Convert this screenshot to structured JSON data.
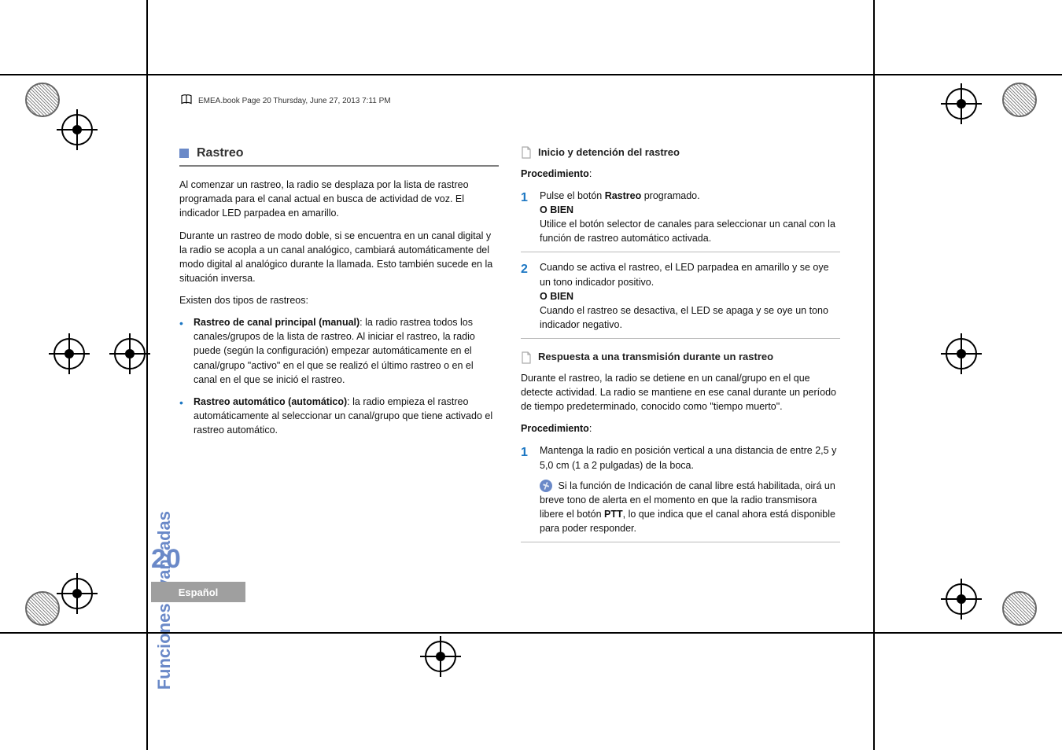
{
  "header": {
    "text": "EMEA.book  Page 20  Thursday, June 27, 2013  7:11 PM"
  },
  "side_tab": "Funciones avanzadas",
  "page_number": "20",
  "language": "Español",
  "left": {
    "title": "Rastreo",
    "p1": "Al comenzar un rastreo, la radio se desplaza por la lista de rastreo programada para el canal actual en busca de actividad de voz. El indicador LED parpadea en amarillo.",
    "p2": "Durante un rastreo de modo doble, si se encuentra en un canal digital y la radio se acopla a un canal analógico, cambiará automáticamente del modo digital al analógico durante la llamada. Esto también sucede en la situación inversa.",
    "p3": "Existen dos tipos de rastreos:",
    "b1_bold": "Rastreo de canal principal (manual)",
    "b1_rest": ": la radio rastrea todos los canales/grupos de la lista de rastreo. Al iniciar el rastreo, la radio puede (según la configuración) empezar automáticamente en el canal/grupo \"activo\" en el que se realizó el último rastreo o en el canal en el que se inició el rastreo.",
    "b2_bold": "Rastreo automático (automático)",
    "b2_rest": ": la radio empieza el rastreo automáticamente al seleccionar un canal/grupo que tiene activado el rastreo automático."
  },
  "right": {
    "h1": "Inicio y detención del rastreo",
    "proc": "Procedimiento",
    "s1_a": "Pulse el botón ",
    "s1_bold": "Rastreo",
    "s1_b": " programado.",
    "obien": "O BIEN",
    "s1_c": "Utilice el botón selector de canales para seleccionar un canal con la función de rastreo automático activada.",
    "s2_a": "Cuando se activa el rastreo, el LED parpadea en amarillo y se oye un tono indicador positivo.",
    "s2_b": "Cuando el rastreo se desactiva, el LED se apaga y se oye un tono indicador negativo.",
    "h2": "Respuesta a una transmisión durante un rastreo",
    "p_intro": "Durante el rastreo, la radio se detiene en un canal/grupo en el que detecte actividad. La radio se mantiene en ese canal durante un período de tiempo predeterminado, conocido como \"tiempo muerto\".",
    "s3": "Mantenga la radio en posición vertical a una distancia de entre 2,5 y 5,0 cm (1 a 2 pulgadas) de la boca.",
    "note_a": "Si la función de Indicación de canal libre está habilitada, oirá un breve tono de alerta en el momento en que la radio transmisora libere el botón ",
    "note_bold": "PTT",
    "note_b": ", lo que indica que el canal ahora está disponible para poder responder."
  }
}
